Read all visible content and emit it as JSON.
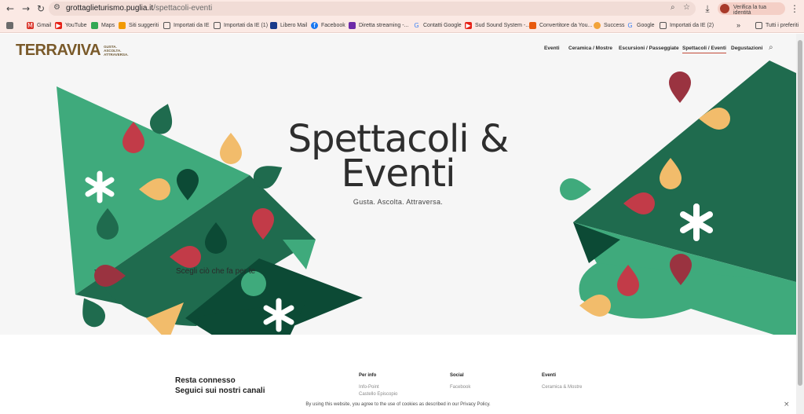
{
  "browser": {
    "url_host": "grottaglieturismo.puglia.it",
    "url_path": "/spettacoli-eventi",
    "verify_label": "Verifica la tua identità",
    "bookmarks": [
      "Gmail",
      "YouTube",
      "Maps",
      "Siti suggeriti",
      "Importati da IE",
      "Importati da IE (1)",
      "Libero Mail",
      "Facebook",
      "Diretta streaming -...",
      "Contatti Google",
      "Sud Sound System -...",
      "Convertitore da You...",
      "Success",
      "Google",
      "Importati da IE (2)"
    ],
    "all_bookmarks_label": "Tutti i preferiti"
  },
  "site": {
    "logo_text": "TERRAVIVA",
    "logo_tagline": [
      "GUSTA.",
      "ASCOLTA.",
      "ATTRAVERSA."
    ],
    "nav": [
      "Eventi",
      "Ceramica / Mostre",
      "Escursioni / Passeggiate",
      "Spettacoli / Eventi",
      "Degustazioni"
    ],
    "active_nav": "Spettacoli / Eventi"
  },
  "hero": {
    "title_line1": "Spettacoli &",
    "title_line2": "Eventi",
    "subtitle": "Gusta. Ascolta. Attraversa.",
    "cta": "Scegli ciò che fa per te"
  },
  "footer": {
    "title_line1": "Resta connesso",
    "title_line2": "Seguici sui nostri canali",
    "col_perinfo": "Per info",
    "col_perinfo_links": [
      "Info-Point",
      "Castello Episcopio"
    ],
    "col_social": "Social",
    "col_social_links": [
      "Facebook"
    ],
    "col_eventi": "Eventi",
    "col_eventi_links": [
      "Ceramica & Mostre"
    ]
  },
  "cookie": {
    "text": "By using this website, you agree to the use of cookies as described in our Privacy Policy."
  },
  "colors": {
    "green_light": "#3faa7c",
    "green_dark": "#1f6b4e",
    "green_deep": "#0c4a35",
    "red": "#c23b48",
    "maroon": "#9a3340",
    "yellow": "#f2bc6b",
    "logo_red": "#c24b3a",
    "logo_brown": "#7a5a2a"
  }
}
